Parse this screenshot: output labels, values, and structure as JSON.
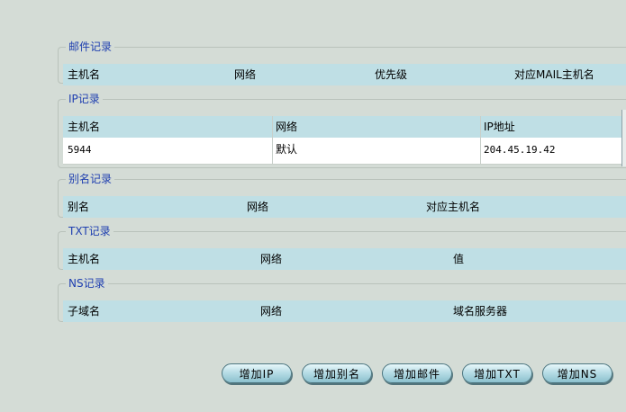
{
  "mail": {
    "legend": "邮件记录",
    "headers": [
      "主机名",
      "网络",
      "优先级",
      "对应MAIL主机名"
    ]
  },
  "ip": {
    "legend": "IP记录",
    "headers": [
      "主机名",
      "网络",
      "IP地址"
    ],
    "rows": [
      [
        "5944",
        "默认",
        "204.45.19.42"
      ]
    ]
  },
  "alias": {
    "legend": "别名记录",
    "headers": [
      "别名",
      "网络",
      "对应主机名"
    ]
  },
  "txt": {
    "legend": "TXT记录",
    "headers": [
      "主机名",
      "网络",
      "值"
    ]
  },
  "ns": {
    "legend": "NS记录",
    "headers": [
      "子域名",
      "网络",
      "域名服务器"
    ]
  },
  "buttons": {
    "add_ip": "增加IP",
    "add_alias": "增加别名",
    "add_mail": "增加邮件",
    "add_txt": "增加TXT",
    "add_ns": "增加NS"
  }
}
